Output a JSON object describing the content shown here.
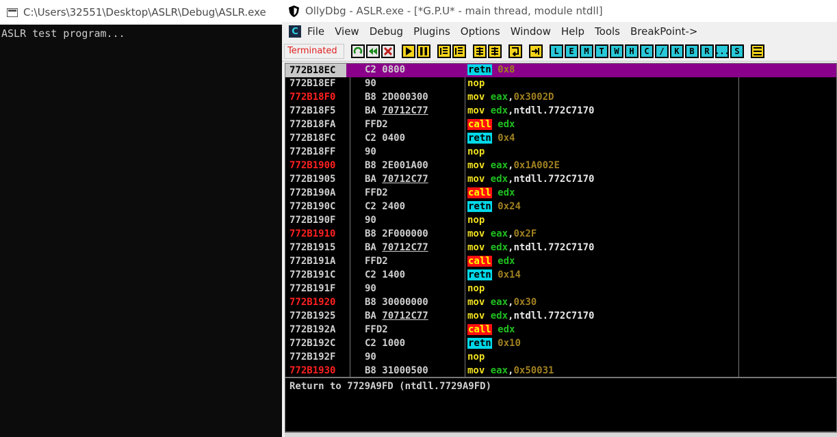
{
  "console": {
    "title": "C:\\Users\\32551\\Desktop\\ASLR\\Debug\\ASLR.exe",
    "output": "ASLR test program..."
  },
  "olly": {
    "title": "OllyDbg - ASLR.exe - [*G.P.U* - main thread, module ntdll]",
    "menu": [
      "File",
      "View",
      "Debug",
      "Plugins",
      "Options",
      "Window",
      "Help",
      "Tools",
      "BreakPoint->"
    ],
    "app_icon_letter": "C",
    "status": "Terminated",
    "toolbar_letters": [
      "L",
      "E",
      "M",
      "T",
      "W",
      "H",
      "C",
      "/",
      "K",
      "B",
      "R",
      "...",
      "S"
    ],
    "info_line": "Return to 7729A9FD (ntdll.7729A9FD)"
  },
  "disasm_rows": [
    {
      "addr": "772B18EC",
      "red": false,
      "sel": true,
      "hex": "C2 0800",
      "ul": "",
      "mn": "retn",
      "op": [
        [
          "imm",
          "0x8"
        ]
      ]
    },
    {
      "addr": "772B18EF",
      "red": false,
      "sel": false,
      "hex": "90",
      "ul": "",
      "mn": "nop",
      "op": []
    },
    {
      "addr": "772B18F0",
      "red": true,
      "sel": false,
      "hex": "B8 2D000300",
      "ul": "",
      "mn": "mov",
      "op": [
        [
          "reg",
          "eax"
        ],
        [
          "plain",
          ","
        ],
        [
          "imm",
          "0x3002D"
        ]
      ]
    },
    {
      "addr": "772B18F5",
      "red": false,
      "sel": false,
      "hex": "BA ",
      "ul": "70712C77",
      "mn": "mov",
      "op": [
        [
          "reg",
          "edx"
        ],
        [
          "plain",
          ",ntdll.772C7170"
        ]
      ]
    },
    {
      "addr": "772B18FA",
      "red": false,
      "sel": false,
      "hex": "FFD2",
      "ul": "",
      "mn": "call",
      "op": [
        [
          "reg",
          "edx"
        ]
      ]
    },
    {
      "addr": "772B18FC",
      "red": false,
      "sel": false,
      "hex": "C2 0400",
      "ul": "",
      "mn": "retn",
      "op": [
        [
          "imm",
          "0x4"
        ]
      ]
    },
    {
      "addr": "772B18FF",
      "red": false,
      "sel": false,
      "hex": "90",
      "ul": "",
      "mn": "nop",
      "op": []
    },
    {
      "addr": "772B1900",
      "red": true,
      "sel": false,
      "hex": "B8 2E001A00",
      "ul": "",
      "mn": "mov",
      "op": [
        [
          "reg",
          "eax"
        ],
        [
          "plain",
          ","
        ],
        [
          "imm",
          "0x1A002E"
        ]
      ]
    },
    {
      "addr": "772B1905",
      "red": false,
      "sel": false,
      "hex": "BA ",
      "ul": "70712C77",
      "mn": "mov",
      "op": [
        [
          "reg",
          "edx"
        ],
        [
          "plain",
          ",ntdll.772C7170"
        ]
      ]
    },
    {
      "addr": "772B190A",
      "red": false,
      "sel": false,
      "hex": "FFD2",
      "ul": "",
      "mn": "call",
      "op": [
        [
          "reg",
          "edx"
        ]
      ]
    },
    {
      "addr": "772B190C",
      "red": false,
      "sel": false,
      "hex": "C2 2400",
      "ul": "",
      "mn": "retn",
      "op": [
        [
          "imm",
          "0x24"
        ]
      ]
    },
    {
      "addr": "772B190F",
      "red": false,
      "sel": false,
      "hex": "90",
      "ul": "",
      "mn": "nop",
      "op": []
    },
    {
      "addr": "772B1910",
      "red": true,
      "sel": false,
      "hex": "B8 2F000000",
      "ul": "",
      "mn": "mov",
      "op": [
        [
          "reg",
          "eax"
        ],
        [
          "plain",
          ","
        ],
        [
          "imm",
          "0x2F"
        ]
      ]
    },
    {
      "addr": "772B1915",
      "red": false,
      "sel": false,
      "hex": "BA ",
      "ul": "70712C77",
      "mn": "mov",
      "op": [
        [
          "reg",
          "edx"
        ],
        [
          "plain",
          ",ntdll.772C7170"
        ]
      ]
    },
    {
      "addr": "772B191A",
      "red": false,
      "sel": false,
      "hex": "FFD2",
      "ul": "",
      "mn": "call",
      "op": [
        [
          "reg",
          "edx"
        ]
      ]
    },
    {
      "addr": "772B191C",
      "red": false,
      "sel": false,
      "hex": "C2 1400",
      "ul": "",
      "mn": "retn",
      "op": [
        [
          "imm",
          "0x14"
        ]
      ]
    },
    {
      "addr": "772B191F",
      "red": false,
      "sel": false,
      "hex": "90",
      "ul": "",
      "mn": "nop",
      "op": []
    },
    {
      "addr": "772B1920",
      "red": true,
      "sel": false,
      "hex": "B8 30000000",
      "ul": "",
      "mn": "mov",
      "op": [
        [
          "reg",
          "eax"
        ],
        [
          "plain",
          ","
        ],
        [
          "imm",
          "0x30"
        ]
      ]
    },
    {
      "addr": "772B1925",
      "red": false,
      "sel": false,
      "hex": "BA ",
      "ul": "70712C77",
      "mn": "mov",
      "op": [
        [
          "reg",
          "edx"
        ],
        [
          "plain",
          ",ntdll.772C7170"
        ]
      ]
    },
    {
      "addr": "772B192A",
      "red": false,
      "sel": false,
      "hex": "FFD2",
      "ul": "",
      "mn": "call",
      "op": [
        [
          "reg",
          "edx"
        ]
      ]
    },
    {
      "addr": "772B192C",
      "red": false,
      "sel": false,
      "hex": "C2 1000",
      "ul": "",
      "mn": "retn",
      "op": [
        [
          "imm",
          "0x10"
        ]
      ]
    },
    {
      "addr": "772B192F",
      "red": false,
      "sel": false,
      "hex": "90",
      "ul": "",
      "mn": "nop",
      "op": []
    },
    {
      "addr": "772B1930",
      "red": true,
      "sel": false,
      "hex": "B8 31000500",
      "ul": "",
      "mn": "mov",
      "op": [
        [
          "reg",
          "eax"
        ],
        [
          "plain",
          ","
        ],
        [
          "imm",
          "0x50031"
        ]
      ]
    }
  ]
}
